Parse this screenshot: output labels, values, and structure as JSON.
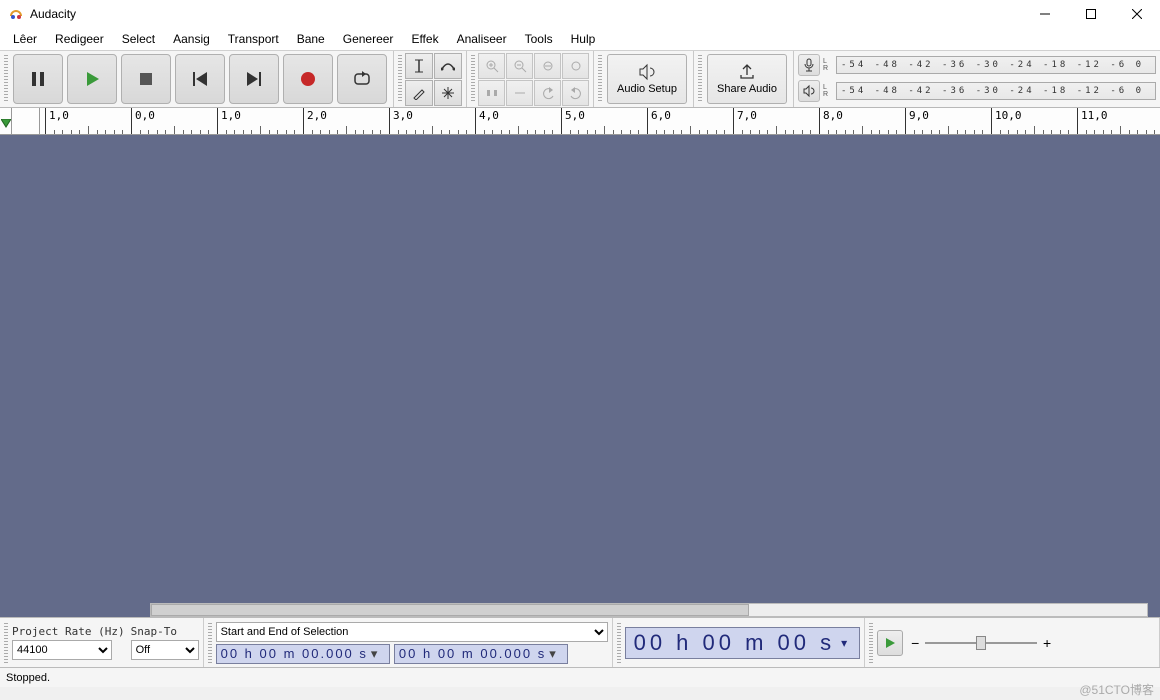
{
  "window": {
    "title": "Audacity"
  },
  "menu": [
    "Lêer",
    "Redigeer",
    "Select",
    "Aansig",
    "Transport",
    "Bane",
    "Genereer",
    "Effek",
    "Analiseer",
    "Tools",
    "Hulp"
  ],
  "toolbar": {
    "audio_setup": "Audio Setup",
    "share_audio": "Share Audio"
  },
  "meters": {
    "rec_ticks": "-54 -48 -42 -36 -30 -24 -18 -12  -6  0",
    "play_ticks": "-54 -48 -42 -36 -30 -24 -18 -12  -6  0",
    "lr": "L\nR"
  },
  "ruler": {
    "ticks": [
      "1,0",
      "0,0",
      "1,0",
      "2,0",
      "3,0",
      "4,0",
      "5,0",
      "6,0",
      "7,0",
      "8,0",
      "9,0",
      "10,0",
      "11,0"
    ]
  },
  "bottom": {
    "project_rate_label": "Project Rate (Hz)",
    "project_rate_value": "44100",
    "snap_label": "Snap-To",
    "snap_value": "Off",
    "selection_label": "Start and End of Selection",
    "time1": "00 h 00 m 00.000 s",
    "time2": "00 h 00 m 00.000 s",
    "big_time": "00 h 00 m 00 s"
  },
  "status": {
    "text": "Stopped."
  },
  "watermark": "@51CTO博客"
}
